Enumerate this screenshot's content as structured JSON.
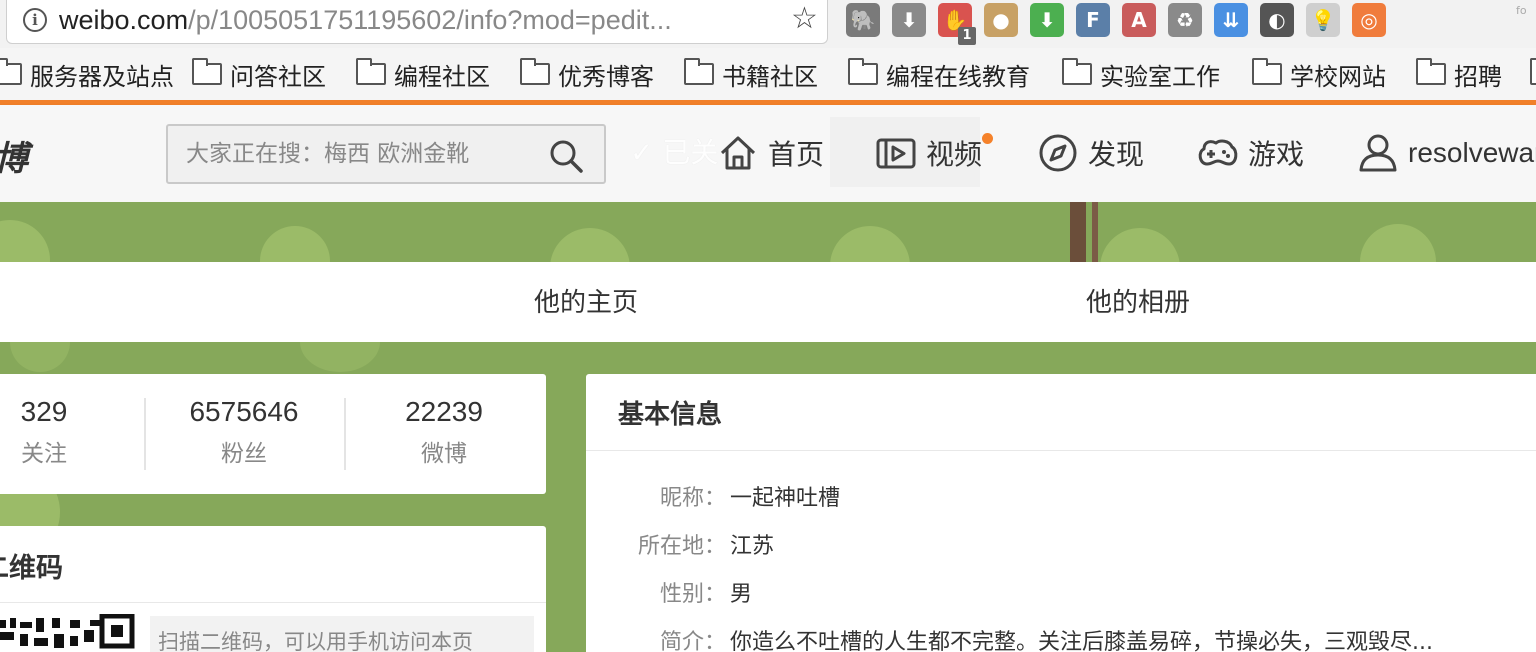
{
  "browser": {
    "url_host": "weibo.com",
    "url_path": "/p/1005051751195602/info?mod=pedit...",
    "extensions": [
      {
        "name": "evernote-icon",
        "color": "#7a7a7a",
        "glyph": "🐘"
      },
      {
        "name": "pocket-icon",
        "color": "#8a8a8a",
        "glyph": "⬇"
      },
      {
        "name": "adblock-icon",
        "color": "#d9534f",
        "glyph": "✋",
        "badge": "1"
      },
      {
        "name": "cookie-icon",
        "color": "#c8a165",
        "glyph": "●"
      },
      {
        "name": "download-icon",
        "color": "#4caf50",
        "glyph": "⬇"
      },
      {
        "name": "feedly-icon",
        "color": "#5b7fa8",
        "glyph": "F"
      },
      {
        "name": "pdf-icon",
        "color": "#c95c5c",
        "glyph": "A"
      },
      {
        "name": "recycle-icon",
        "color": "#8a8a8a",
        "glyph": "♻"
      },
      {
        "name": "save-icon",
        "color": "#4a90e2",
        "glyph": "⇊"
      },
      {
        "name": "mask-icon",
        "color": "#555555",
        "glyph": "◐"
      },
      {
        "name": "bulb-icon",
        "color": "#cfcfcf",
        "glyph": "💡"
      },
      {
        "name": "lifebuoy-icon",
        "color": "#f07c3c",
        "glyph": "◎"
      }
    ],
    "ext_tail": "fo"
  },
  "bookmarks": [
    "服务器及站点",
    "问答社区",
    "编程社区",
    "优秀博客",
    "书籍社区",
    "编程在线教育",
    "实验室工作",
    "学校网站",
    "招聘"
  ],
  "nav": {
    "logo": "博",
    "search_placeholder": "大家正在搜：梅西 欧洲金靴",
    "followed_ghost": "✓ 已关",
    "items": [
      {
        "label": "首页",
        "icon": "home-icon"
      },
      {
        "label": "视频",
        "icon": "video-icon"
      },
      {
        "label": "发现",
        "icon": "compass-icon"
      },
      {
        "label": "游戏",
        "icon": "gamepad-icon"
      },
      {
        "label": "resolvewang",
        "icon": "user-icon"
      }
    ],
    "accent": "#f5822b"
  },
  "tabs": [
    "他的主页",
    "他的相册"
  ],
  "stats": [
    {
      "value": "329",
      "label": "关注"
    },
    {
      "value": "6575646",
      "label": "粉丝"
    },
    {
      "value": "22239",
      "label": "微博"
    }
  ],
  "qr": {
    "title": "二维码",
    "tip": "扫描二维码，可以用手机访问本页"
  },
  "info": {
    "title": "基本信息",
    "rows": [
      {
        "label": "昵称：",
        "value": "一起神吐槽"
      },
      {
        "label": "所在地：",
        "value": "江苏"
      },
      {
        "label": "性别：",
        "value": "男"
      },
      {
        "label": "简介：",
        "value": "你造么不吐槽的人生都不完整。关注后膝盖易碎，节操必失，三观毁尽..."
      }
    ]
  },
  "colors": {
    "cover_green": "#86a85a",
    "orange_line": "#f1802a"
  }
}
